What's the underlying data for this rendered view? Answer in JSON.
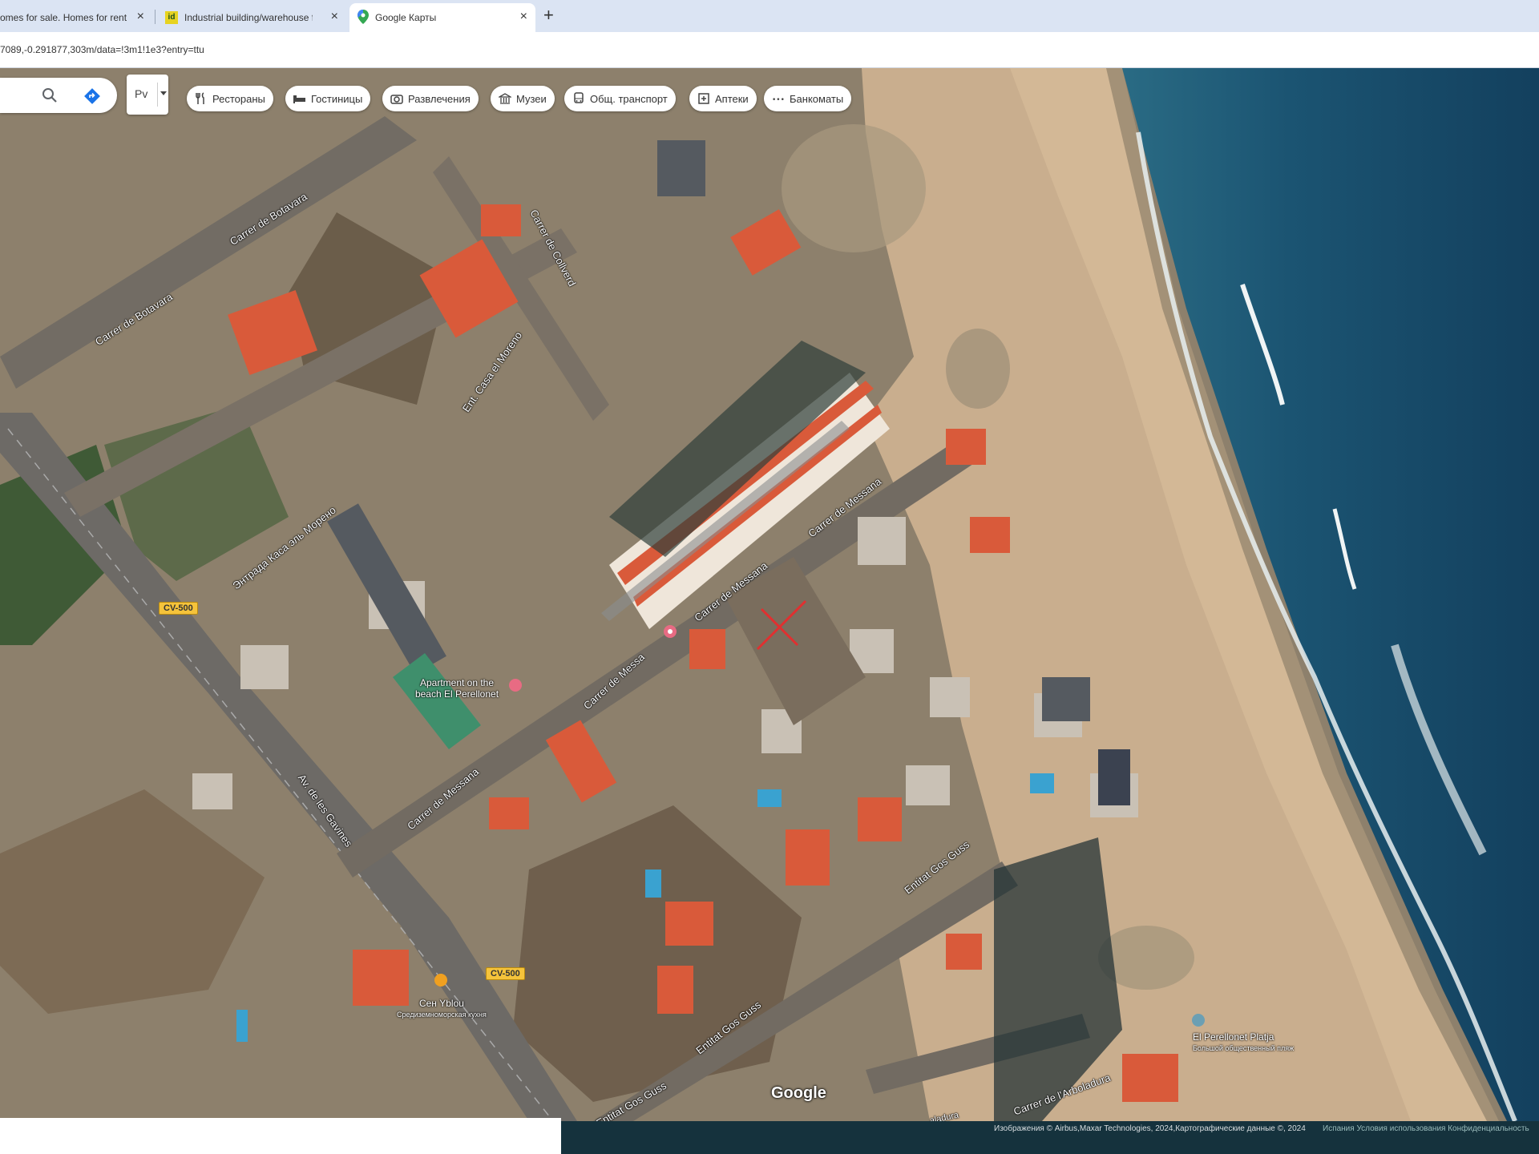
{
  "browser": {
    "tabs": [
      {
        "title": "omes for sale. Homes for rent",
        "active": false
      },
      {
        "title": "Industrial building/warehouse f",
        "favicon_text": "id",
        "active": false
      },
      {
        "title": "Google Карты",
        "favicon": "maps-pin-icon",
        "active": true
      }
    ],
    "new_tab_symbol": "+",
    "close_symbol": "×",
    "url": "7089,-0.291877,303m/data=!3m1!1e3?entry=ttu"
  },
  "map": {
    "search_icon": "search-icon",
    "directions_icon": "directions-icon",
    "layer_label": "Рv",
    "categories": [
      {
        "label": "Рестораны",
        "icon": "fork-knife-icon"
      },
      {
        "label": "Гостиницы",
        "icon": "bed-icon"
      },
      {
        "label": "Развлечения",
        "icon": "camera-icon"
      },
      {
        "label": "Музеи",
        "icon": "museum-icon"
      },
      {
        "label": "Общ. транспорт",
        "icon": "bus-icon"
      },
      {
        "label": "Аптеки",
        "icon": "pharmacy-icon"
      },
      {
        "label": "Банкоматы",
        "icon": "atm-icon"
      }
    ],
    "streets": {
      "botavara_top": "Carrer de Botavara",
      "botavara_mid": "Carrer de Botavara",
      "colivert": "Carrer de Collverd",
      "casa_moreno": "Ent. Casa el Moreno",
      "casa_moreno_ru": "Энтрада Каса эль Морено",
      "messana_1": "Carrer de Messana",
      "messana_2": "Carrer de Messana",
      "messana_3": "Carrer de Messa",
      "messana_4": "Carrer de Messana",
      "gavines": "Av. de les Gavines",
      "gos_guss_1": "Entitat Gos Guss",
      "gos_guss_2": "Entitat Gos Guss",
      "gos_guss_3": "Entitat Gos Guss",
      "arboladura": "Carrer de l'Arboladura",
      "arboladura_2": "aladura"
    },
    "road_signs": [
      "CV-500",
      "CV-500"
    ],
    "pois": {
      "apartment": "Apartment on the beach El Perellonet",
      "restaurant": "Ceн Yblou",
      "restaurant_sub": "Средиземноморская кухня",
      "beach": "El Perellonet Platja",
      "beach_sub": "Большой общественный пляж"
    },
    "google_logo": "Google",
    "attribution": "Изображения © Airbus,Maxar Technologies, 2024,Картографические данные ©, 2024",
    "links": "Испания    Условия использования    Конфиденциальность"
  },
  "colors": {
    "tabbar": "#dbe4f3",
    "sea": "#1b4f6e",
    "sand": "#c8ad8d",
    "roof_red": "#d95a3a",
    "marker": "#e03030"
  }
}
